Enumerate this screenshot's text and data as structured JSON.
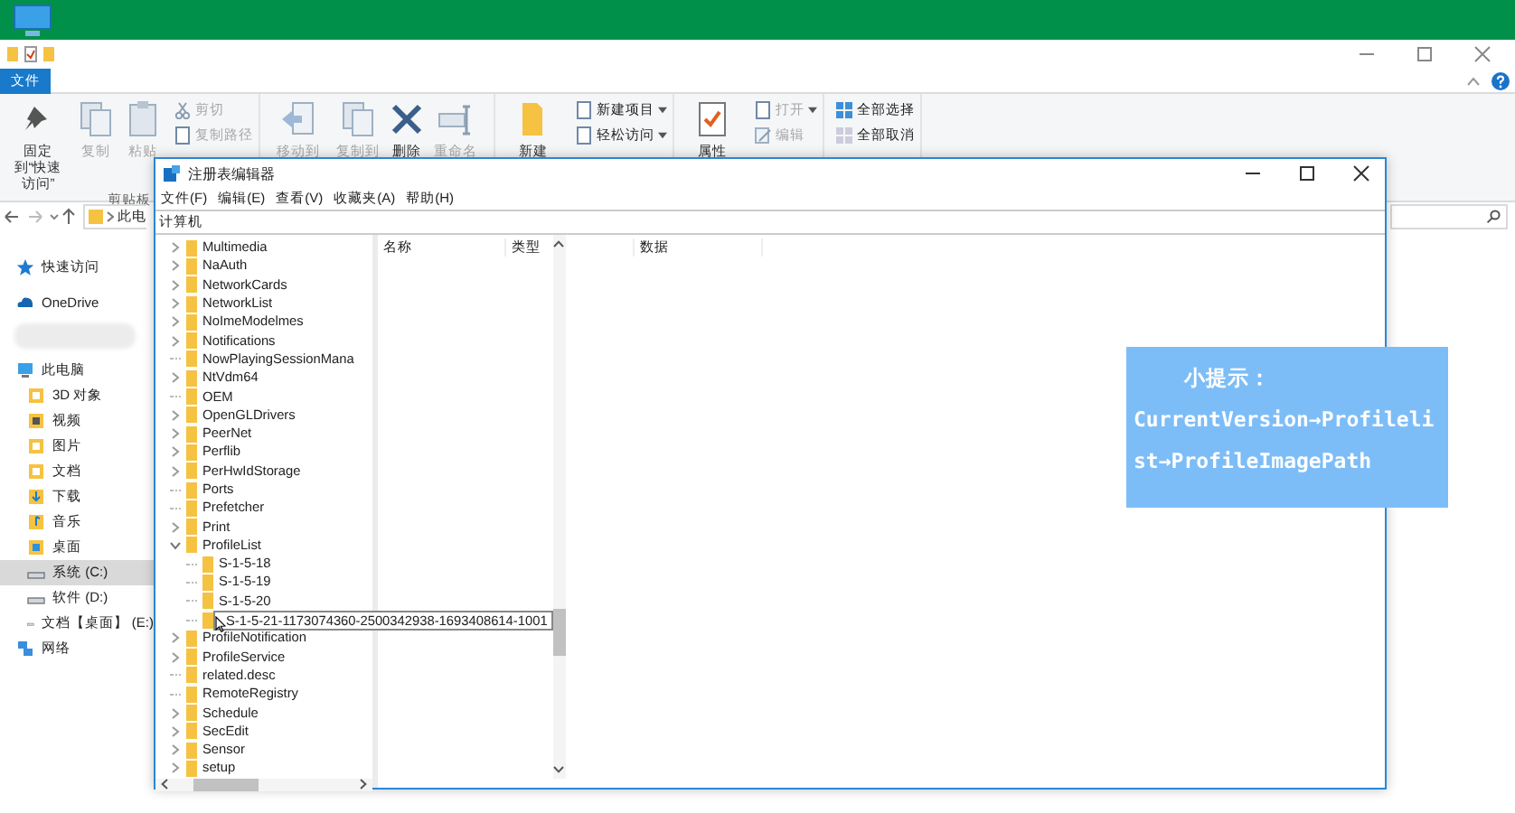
{
  "explorer": {
    "tabs": [
      {
        "label": "文件",
        "selected": true
      }
    ],
    "ribbon": [
      {
        "label": "剪贴板",
        "buttons": [
          {
            "kind": "large",
            "label": "固定到“快速访问”",
            "disabled": false
          },
          {
            "kind": "large",
            "label": "复制",
            "disabled": true
          },
          {
            "kind": "large",
            "label": "粘贴",
            "disabled": true
          },
          {
            "kind": "small",
            "label": "剪切",
            "disabled": true,
            "dropdown": false
          },
          {
            "kind": "small",
            "label": "复制路径",
            "disabled": true,
            "dropdown": false
          }
        ]
      },
      {
        "buttons": [
          {
            "kind": "large",
            "label": "移动到",
            "disabled": true
          },
          {
            "kind": "large",
            "label": "复制到",
            "disabled": true
          },
          {
            "kind": "large",
            "label": "删除",
            "disabled": false
          },
          {
            "kind": "large",
            "label": "重命名",
            "disabled": true
          }
        ]
      },
      {
        "buttons": [
          {
            "kind": "large",
            "label": "新建",
            "disabled": false
          },
          {
            "kind": "small",
            "label": "新建项目",
            "disabled": false,
            "dropdown": true
          },
          {
            "kind": "small",
            "label": "轻松访问",
            "disabled": false,
            "dropdown": true
          }
        ]
      },
      {
        "buttons": [
          {
            "kind": "large",
            "label": "属性",
            "disabled": false
          },
          {
            "kind": "small",
            "label": "打开",
            "disabled": true,
            "dropdown": true
          },
          {
            "kind": "small",
            "label": "编辑",
            "disabled": true,
            "dropdown": false
          }
        ]
      },
      {
        "buttons": [
          {
            "kind": "small",
            "label": "全部选择",
            "disabled": false,
            "dropdown": false
          },
          {
            "kind": "small",
            "label": "全部取消",
            "disabled": false,
            "dropdown": false
          }
        ]
      }
    ],
    "address": "此电",
    "nav": [
      {
        "kind": "item",
        "label": "快速访问",
        "selected": false
      },
      {
        "kind": "item",
        "label": "OneDrive",
        "selected": false
      },
      {
        "kind": "blurred"
      },
      {
        "kind": "item",
        "label": "此电脑",
        "selected": false,
        "children": [
          {
            "label": "3D 对象",
            "selected": false
          },
          {
            "label": "视频",
            "selected": false
          },
          {
            "label": "图片",
            "selected": false
          },
          {
            "label": "文档",
            "selected": false
          },
          {
            "label": "下载",
            "selected": false
          },
          {
            "label": "音乐",
            "selected": false
          },
          {
            "label": "桌面",
            "selected": false
          },
          {
            "label": "系统 (C:)",
            "selected": true
          },
          {
            "label": "软件 (D:)",
            "selected": false
          },
          {
            "label": "文档【桌面】 (E:)",
            "selected": false
          }
        ]
      },
      {
        "kind": "item",
        "label": "网络",
        "selected": false
      }
    ]
  },
  "regedit": {
    "title": "注册表编辑器",
    "menu": [
      "文件(F)",
      "编辑(E)",
      "查看(V)",
      "收藏夹(A)",
      "帮助(H)"
    ],
    "address": "计算机",
    "columns": [
      "名称",
      "类型",
      "数据"
    ],
    "tree": [
      {
        "name": "Multimedia",
        "expandable": true,
        "expanded": false
      },
      {
        "name": "NaAuth",
        "expandable": true,
        "expanded": false
      },
      {
        "name": "NetworkCards",
        "expandable": true,
        "expanded": false
      },
      {
        "name": "NetworkList",
        "expandable": true,
        "expanded": false
      },
      {
        "name": "NoImeModelmes",
        "expandable": true,
        "expanded": false
      },
      {
        "name": "Notifications",
        "expandable": true,
        "expanded": false
      },
      {
        "name": "NowPlayingSessionMana",
        "expandable": false
      },
      {
        "name": "NtVdm64",
        "expandable": true,
        "expanded": false
      },
      {
        "name": "OEM",
        "expandable": false
      },
      {
        "name": "OpenGLDrivers",
        "expandable": true,
        "expanded": false
      },
      {
        "name": "PeerNet",
        "expandable": true,
        "expanded": false
      },
      {
        "name": "Perflib",
        "expandable": true,
        "expanded": false
      },
      {
        "name": "PerHwIdStorage",
        "expandable": true,
        "expanded": false
      },
      {
        "name": "Ports",
        "expandable": false
      },
      {
        "name": "Prefetcher",
        "expandable": false
      },
      {
        "name": "Print",
        "expandable": true,
        "expanded": false
      },
      {
        "name": "ProfileList",
        "expandable": true,
        "expanded": true,
        "children": [
          {
            "name": "S-1-5-18",
            "expandable": false,
            "tooltip": false
          },
          {
            "name": "S-1-5-19",
            "expandable": false,
            "tooltip": false
          },
          {
            "name": "S-1-5-20",
            "expandable": false,
            "tooltip": false
          },
          {
            "name": "S-1-5-21-1173074360-2500342938-1693408614-1001",
            "expandable": false,
            "tooltip": true
          }
        ]
      },
      {
        "name": "ProfileNotification",
        "expandable": true,
        "expanded": false
      },
      {
        "name": "ProfileService",
        "expandable": true,
        "expanded": false
      },
      {
        "name": "related.desc",
        "expandable": false
      },
      {
        "name": "RemoteRegistry",
        "expandable": false
      },
      {
        "name": "Schedule",
        "expandable": true,
        "expanded": false
      },
      {
        "name": "SecEdit",
        "expandable": true,
        "expanded": false
      },
      {
        "name": "Sensor",
        "expandable": true,
        "expanded": false
      },
      {
        "name": "setup",
        "expandable": true,
        "expanded": false
      }
    ]
  },
  "tip": {
    "title": "小提示：",
    "text": "CurrentVersion→Profilelist→ProfileImagePath"
  }
}
